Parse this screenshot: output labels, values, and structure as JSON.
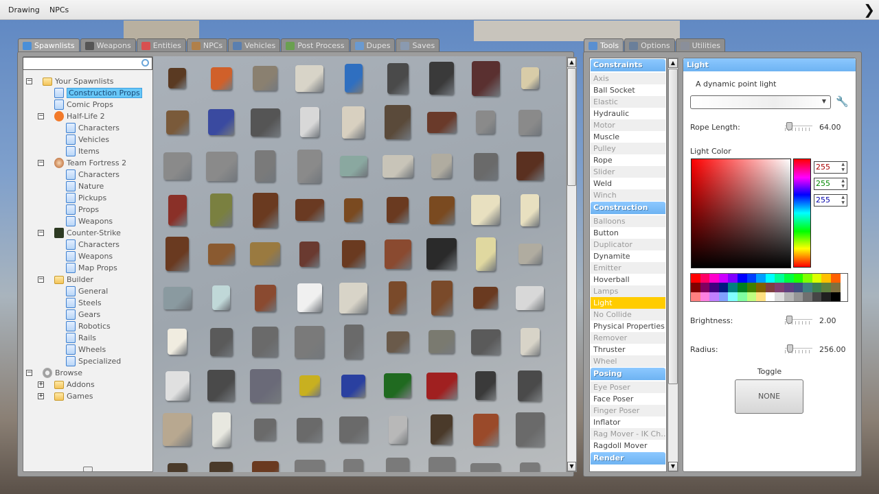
{
  "menubar": {
    "items": [
      "Drawing",
      "NPCs"
    ]
  },
  "left_tabs": [
    {
      "label": "Spawnlists",
      "icon": "spawnlist-icon",
      "color": "#4a8fd8",
      "active": true
    },
    {
      "label": "Weapons",
      "icon": "gun-icon",
      "color": "#555555"
    },
    {
      "label": "Entities",
      "icon": "cubes-icon",
      "color": "#d85050"
    },
    {
      "label": "NPCs",
      "icon": "monkey-icon",
      "color": "#b0804a"
    },
    {
      "label": "Vehicles",
      "icon": "car-icon",
      "color": "#5a7fb0"
    },
    {
      "label": "Post Process",
      "icon": "picture-icon",
      "color": "#6aa050"
    },
    {
      "label": "Dupes",
      "icon": "dupe-icon",
      "color": "#6a9ad0"
    },
    {
      "label": "Saves",
      "icon": "saves-icon",
      "color": "#8a9ab0"
    }
  ],
  "right_tabs": [
    {
      "label": "Tools",
      "icon": "wrench-icon",
      "color": "#5a8fd0",
      "active": true
    },
    {
      "label": "Options",
      "icon": "wrench-icon",
      "color": "#6a7f9a"
    },
    {
      "label": "Utilities",
      "icon": "utilities-icon",
      "color": "#8a8f9a"
    }
  ],
  "search": {
    "value": "",
    "placeholder": ""
  },
  "tree": [
    {
      "label": "Your Spawnlists",
      "level": 0,
      "icon": "folder",
      "toggle": "-"
    },
    {
      "label": "Construction Props",
      "level": 1,
      "icon": "file",
      "selected": true
    },
    {
      "label": "Comic Props",
      "level": 1,
      "icon": "file"
    },
    {
      "label": "Half-Life 2",
      "level": 1,
      "icon": "hl2",
      "toggle": "-"
    },
    {
      "label": "Characters",
      "level": 2,
      "icon": "file"
    },
    {
      "label": "Vehicles",
      "level": 2,
      "icon": "file"
    },
    {
      "label": "Items",
      "level": 2,
      "icon": "file"
    },
    {
      "label": "Team Fortress 2",
      "level": 1,
      "icon": "tf2",
      "toggle": "-"
    },
    {
      "label": "Characters",
      "level": 2,
      "icon": "file"
    },
    {
      "label": "Nature",
      "level": 2,
      "icon": "file"
    },
    {
      "label": "Pickups",
      "level": 2,
      "icon": "file"
    },
    {
      "label": "Props",
      "level": 2,
      "icon": "file"
    },
    {
      "label": "Weapons",
      "level": 2,
      "icon": "file"
    },
    {
      "label": "Counter-Strike",
      "level": 1,
      "icon": "cs",
      "toggle": "-"
    },
    {
      "label": "Characters",
      "level": 2,
      "icon": "file"
    },
    {
      "label": "Weapons",
      "level": 2,
      "icon": "file"
    },
    {
      "label": "Map Props",
      "level": 2,
      "icon": "file"
    },
    {
      "label": "Builder",
      "level": 1,
      "icon": "folder",
      "toggle": "-"
    },
    {
      "label": "General",
      "level": 2,
      "icon": "file"
    },
    {
      "label": "Steels",
      "level": 2,
      "icon": "file"
    },
    {
      "label": "Gears",
      "level": 2,
      "icon": "file"
    },
    {
      "label": "Robotics",
      "level": 2,
      "icon": "file"
    },
    {
      "label": "Rails",
      "level": 2,
      "icon": "file"
    },
    {
      "label": "Wheels",
      "level": 2,
      "icon": "file"
    },
    {
      "label": "Specialized",
      "level": 2,
      "icon": "file"
    },
    {
      "label": "Browse",
      "level": 0,
      "icon": "gear",
      "toggle": "-"
    },
    {
      "label": "Addons",
      "level": 1,
      "icon": "folder",
      "toggle": "+"
    },
    {
      "label": "Games",
      "level": 1,
      "icon": "folder",
      "toggle": "+"
    }
  ],
  "props": {
    "thumbnail_colors": [
      [
        "#5a3a22",
        "#d0602a",
        "#8a8070",
        "#d8d4c8",
        "#2f6fc0",
        "#4a4a4a",
        "#3a3a3a",
        "#5a3030",
        "#d8cca8"
      ],
      [
        "#7a5a3a",
        "#3a4aa0",
        "#555555",
        "#d8d8d8",
        "#d8d0c0",
        "#5a4a3a",
        "#6a3a2a",
        "#8a8a8a",
        "#8a8a8a"
      ],
      [
        "#8a8a8a",
        "#8a8a8a",
        "#7a7a7a",
        "#8a8a8a",
        "#8aa8a0",
        "#c8c4b8",
        "#b0aca0",
        "#6a6a6a",
        "#5a3020"
      ],
      [
        "#8a3028",
        "#7a8040",
        "#6a3a20",
        "#6a3a22",
        "#7a4a20",
        "#6a3a20",
        "#7a4a20",
        "#e8e0c0",
        "#e8e0c0"
      ],
      [
        "#6a3a20",
        "#8a5a30",
        "#9a7a40",
        "#6a3a30",
        "#6a3a20",
        "#8a4a30",
        "#2a2a2a",
        "#e0d8a0",
        "#b0aca0"
      ],
      [
        "#8a9aa0",
        "#c0d8d8",
        "#8a4a30",
        "#f0f0f0",
        "#d8d4c8",
        "#7a4a2a",
        "#7a4a2a",
        "#6a3a20",
        "#d8d8d8"
      ],
      [
        "#f0ece0",
        "#5a5a5a",
        "#6a6a6a",
        "#7a7a7a",
        "#6a6a6a",
        "#6a5a4a",
        "#7a7a70",
        "#5a5a5a",
        "#d8d4c8"
      ],
      [
        "#e0e0e0",
        "#4a4a4a",
        "#6a6a78",
        "#c8b020",
        "#2a40a0",
        "#206a20",
        "#a02020",
        "#3a3a3a",
        "#4a4a4a"
      ],
      [
        "#b8a890",
        "#e8e8e0",
        "#6a6a6a",
        "#6a6a6a",
        "#6a6a6a",
        "#b8b8b8",
        "#4a3a2a",
        "#9a4a2a",
        "#6a6a6a"
      ],
      [
        "#4a3a2a",
        "#4a3a2a",
        "#6a3a20",
        "#7a7a7a",
        "#7a7a7a",
        "#7a7a7a",
        "#7a7a7a",
        "#7a7a7a",
        "#7a7a7a"
      ]
    ]
  },
  "tools": {
    "categories": [
      {
        "name": "Constraints",
        "items": [
          "Axis",
          "Ball Socket",
          "Elastic",
          "Hydraulic",
          "Motor",
          "Muscle",
          "Pulley",
          "Rope",
          "Slider",
          "Weld",
          "Winch"
        ]
      },
      {
        "name": "Construction",
        "items": [
          "Balloons",
          "Button",
          "Duplicator",
          "Dynamite",
          "Emitter",
          "Hoverball",
          "Lamps",
          "Light",
          "No Collide",
          "Physical Properties",
          "Remover",
          "Thruster",
          "Wheel"
        ],
        "selected": "Light"
      },
      {
        "name": "Posing",
        "items": [
          "Eye Poser",
          "Face Poser",
          "Finger Poser",
          "Inflator",
          "Rag Mover - IK Ch…",
          "Ragdoll Mover"
        ]
      },
      {
        "name": "Render",
        "items": []
      }
    ]
  },
  "settings": {
    "title": "Light",
    "description": "A dynamic point light",
    "preset": {
      "value": "",
      "icon": "wrench-icon"
    },
    "rope_length": {
      "label": "Rope Length:",
      "value": "64.00",
      "fraction": 0.06
    },
    "light_color": {
      "label": "Light Color",
      "r": "255",
      "g": "255",
      "b": "255",
      "hue_color": "#ff0000",
      "palette": [
        [
          "#ff0000",
          "#ff0066",
          "#ff00cc",
          "#cc00ff",
          "#8000ff",
          "#0000ff",
          "#0040ff",
          "#00a0ff",
          "#00ffff",
          "#00ff99",
          "#00ff40",
          "#20ff00",
          "#80ff00",
          "#ddff00",
          "#ffc000",
          "#ff6000"
        ],
        [
          "#800000",
          "#800060",
          "#400080",
          "#001880",
          "#008080",
          "#008020",
          "#408000",
          "#806000",
          "#804040",
          "#804070",
          "#604080",
          "#405080",
          "#408080",
          "#408050",
          "#608040",
          "#807040"
        ],
        [
          "#ff8080",
          "#ff80e0",
          "#c080ff",
          "#80a0ff",
          "#80ffff",
          "#80ffa0",
          "#c0ff80",
          "#ffe080",
          "#ffffff",
          "#dddddd",
          "#b4b4b4",
          "#969696",
          "#707070",
          "#464646",
          "#202020",
          "#000000"
        ]
      ]
    },
    "brightness": {
      "label": "Brightness:",
      "value": "2.00",
      "fraction": 0.05
    },
    "radius": {
      "label": "Radius:",
      "value": "256.00",
      "fraction": 0.1
    },
    "toggle": {
      "label": "Toggle",
      "value": "NONE"
    }
  }
}
